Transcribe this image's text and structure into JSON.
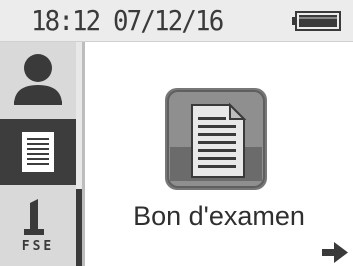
{
  "status_bar": {
    "datetime": "18:12 07/12/16",
    "battery_level": 1.0
  },
  "sidebar": {
    "items": [
      {
        "name": "patient",
        "icon": "person-icon",
        "selected": false
      },
      {
        "name": "document",
        "icon": "document-icon",
        "selected": true
      },
      {
        "name": "fse",
        "icon": "fse-icon",
        "label": "FSE",
        "selected": false
      }
    ]
  },
  "main": {
    "item_label": "Bon d'examen",
    "next_icon": "arrow-right-icon"
  },
  "colors": {
    "status_bar_bg": "#ececec",
    "sidebar_bg": "#d9d9d9",
    "selected_bg": "#3d3d3d",
    "icon_dark": "#3a3a3a"
  }
}
